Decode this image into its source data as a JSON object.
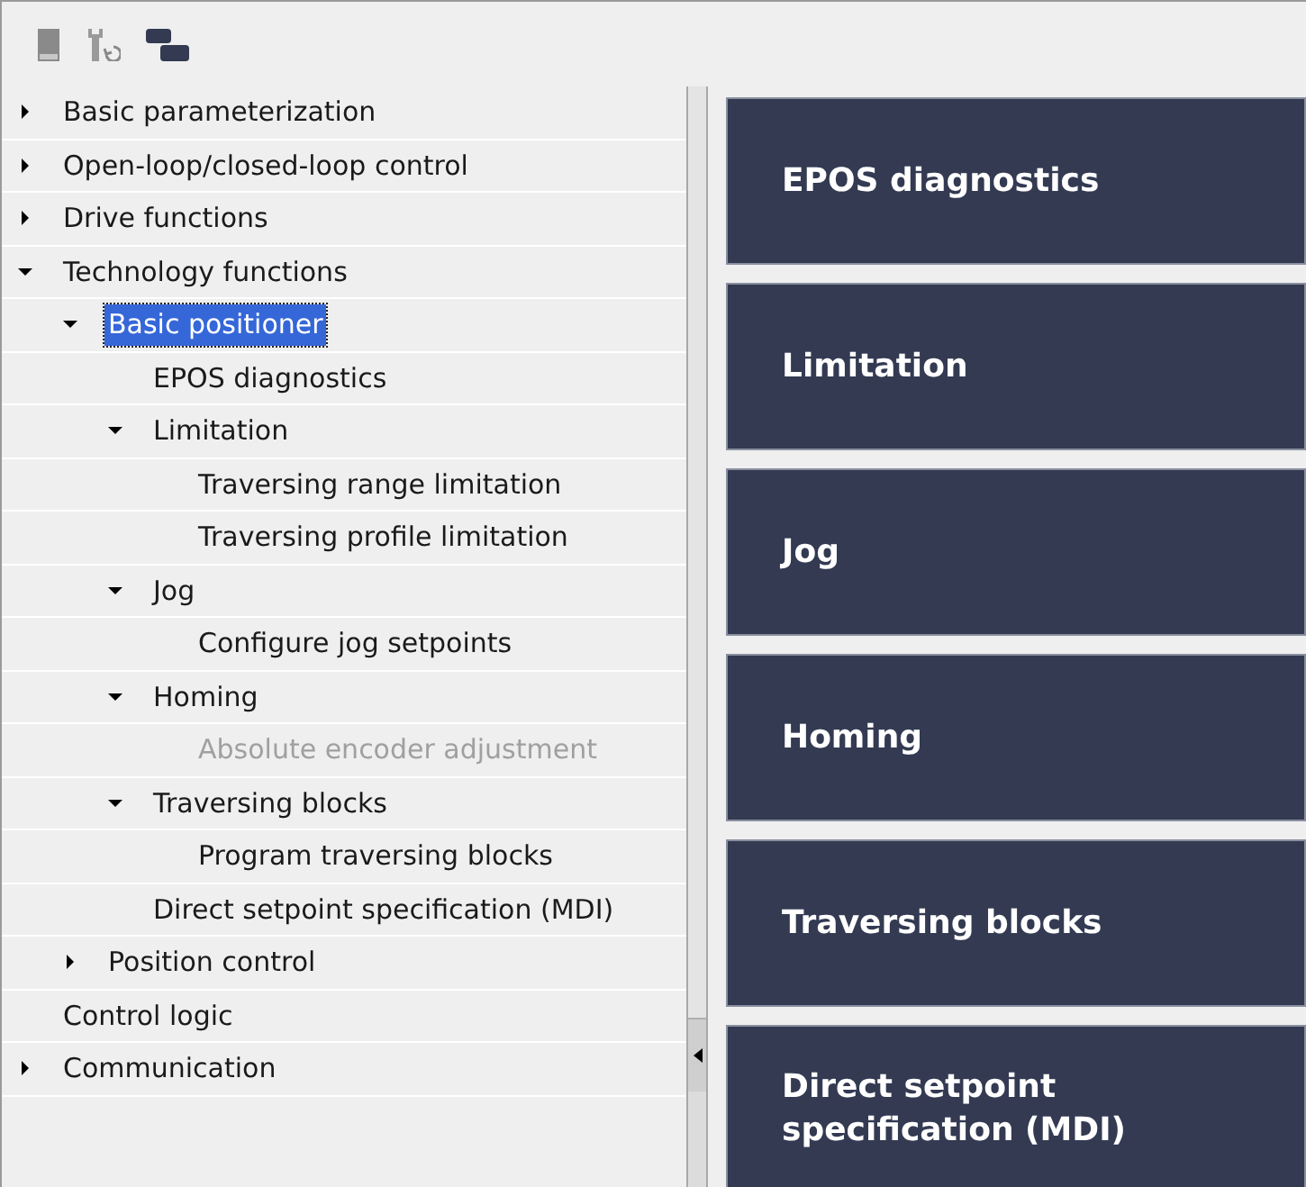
{
  "tree": [
    {
      "label": "Basic parameterization",
      "expanded": false,
      "selected": false,
      "disabled": false
    },
    {
      "label": "Open-loop/closed-loop control",
      "expanded": false,
      "selected": false,
      "disabled": false
    },
    {
      "label": "Drive functions",
      "expanded": false,
      "selected": false,
      "disabled": false
    },
    {
      "label": "Technology functions",
      "expanded": true,
      "selected": false,
      "disabled": false,
      "children": [
        {
          "label": "Basic positioner",
          "expanded": true,
          "selected": true,
          "disabled": false,
          "children": [
            {
              "label": "EPOS diagnostics",
              "selected": false,
              "disabled": false
            },
            {
              "label": "Limitation",
              "expanded": true,
              "selected": false,
              "disabled": false,
              "children": [
                {
                  "label": "Traversing range limitation",
                  "selected": false,
                  "disabled": false
                },
                {
                  "label": "Traversing profile limitation",
                  "selected": false,
                  "disabled": false
                }
              ]
            },
            {
              "label": "Jog",
              "expanded": true,
              "selected": false,
              "disabled": false,
              "children": [
                {
                  "label": "Configure jog setpoints",
                  "selected": false,
                  "disabled": false
                }
              ]
            },
            {
              "label": "Homing",
              "expanded": true,
              "selected": false,
              "disabled": false,
              "children": [
                {
                  "label": "Absolute encoder adjustment",
                  "selected": false,
                  "disabled": true
                }
              ]
            },
            {
              "label": "Traversing blocks",
              "expanded": true,
              "selected": false,
              "disabled": false,
              "children": [
                {
                  "label": "Program traversing blocks",
                  "selected": false,
                  "disabled": false
                }
              ]
            },
            {
              "label": "Direct setpoint specification (MDI)",
              "selected": false,
              "disabled": false
            }
          ]
        },
        {
          "label": "Position control",
          "expanded": false,
          "selected": false,
          "disabled": false
        }
      ]
    },
    {
      "label": "Control logic",
      "selected": false,
      "disabled": false
    },
    {
      "label": "Communication",
      "expanded": false,
      "selected": false,
      "disabled": false
    }
  ],
  "tiles": [
    "EPOS diagnostics",
    "Limitation",
    "Jog",
    "Homing",
    "Traversing blocks",
    "Direct setpoint specification (MDI)"
  ]
}
